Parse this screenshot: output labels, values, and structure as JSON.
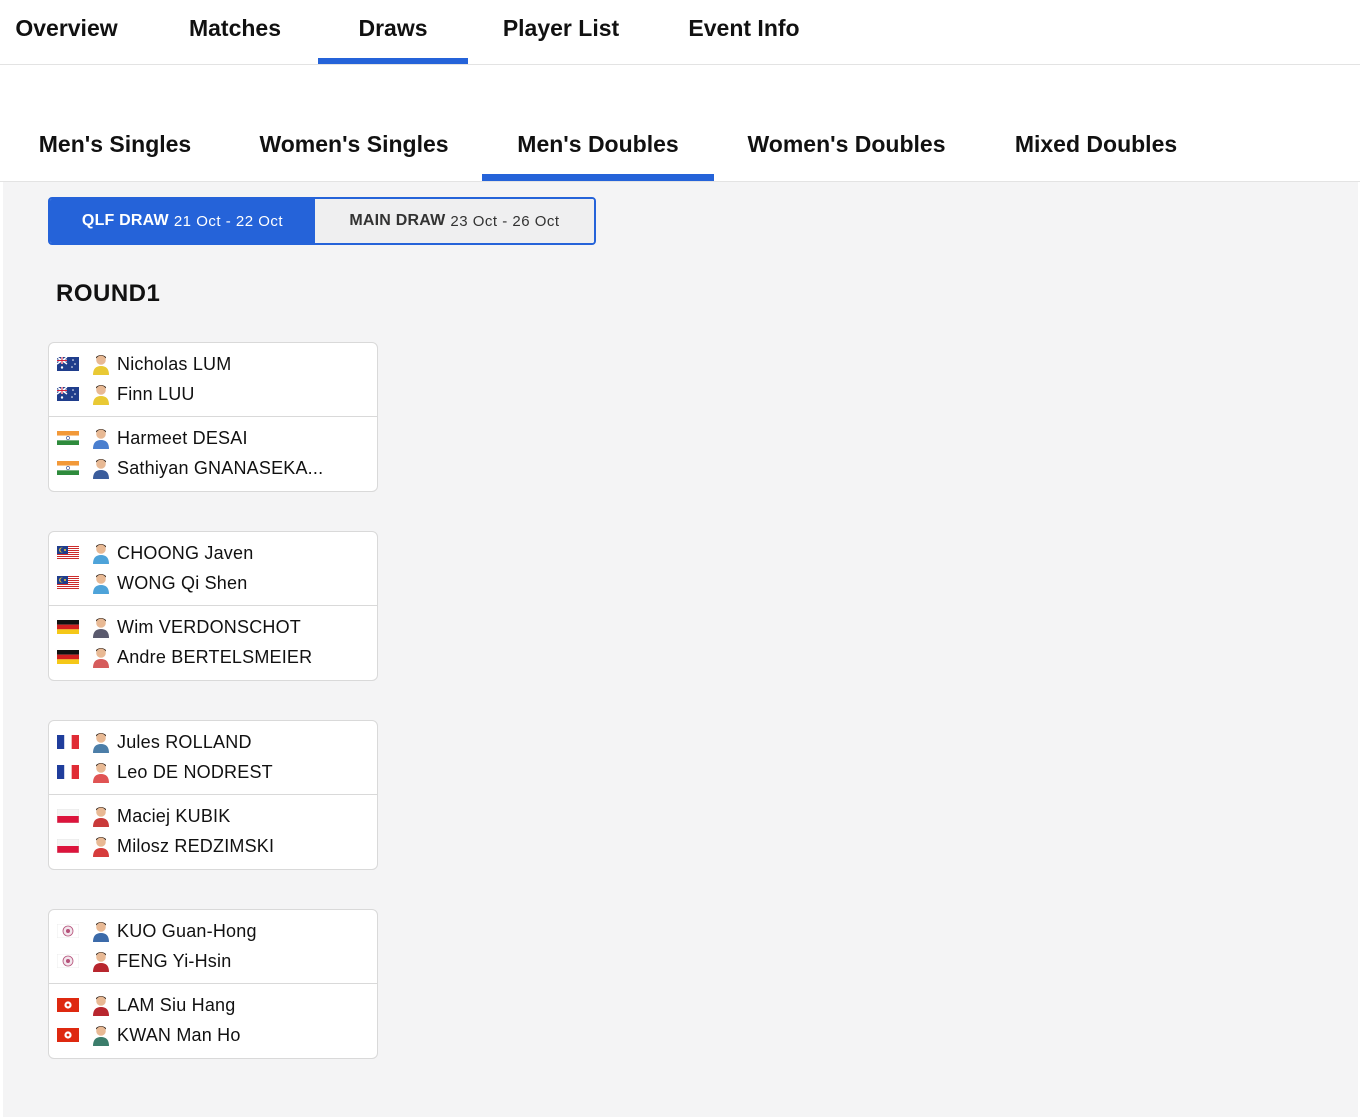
{
  "top_tabs": [
    "Overview",
    "Matches",
    "Draws",
    "Player List",
    "Event Info"
  ],
  "category_tabs": [
    "Men's Singles",
    "Women's Singles",
    "Men's Doubles",
    "Women's Doubles",
    "Mixed Doubles"
  ],
  "draw_toggle": {
    "qlf_label": "QLF DRAW",
    "qlf_dates": "21 Oct - 22 Oct",
    "main_label": "MAIN DRAW",
    "main_dates": "23 Oct - 26 Oct"
  },
  "round_title": "ROUND1",
  "matches": [
    {
      "team1": [
        {
          "name": "Nicholas LUM",
          "flag": "aus-flag-icon"
        },
        {
          "name": "Finn LUU",
          "flag": "aus-flag-icon"
        }
      ],
      "team2": [
        {
          "name": "Harmeet DESAI",
          "flag": "ind-flag-icon"
        },
        {
          "name": "Sathiyan GNANASEKA...",
          "flag": "ind-flag-icon"
        }
      ]
    },
    {
      "team1": [
        {
          "name": "CHOONG Javen",
          "flag": "mas-flag-icon"
        },
        {
          "name": "WONG Qi Shen",
          "flag": "mas-flag-icon"
        }
      ],
      "team2": [
        {
          "name": "Wim VERDONSCHOT",
          "flag": "ger-flag-icon"
        },
        {
          "name": "Andre BERTELSMEIER",
          "flag": "ger-flag-icon"
        }
      ]
    },
    {
      "team1": [
        {
          "name": "Jules ROLLAND",
          "flag": "fra-flag-icon"
        },
        {
          "name": "Leo DE NODREST",
          "flag": "fra-flag-icon"
        }
      ],
      "team2": [
        {
          "name": "Maciej KUBIK",
          "flag": "pol-flag-icon"
        },
        {
          "name": "Milosz REDZIMSKI",
          "flag": "pol-flag-icon"
        }
      ]
    },
    {
      "team1": [
        {
          "name": "KUO Guan-Hong",
          "flag": "tpe-flag-icon"
        },
        {
          "name": "FENG Yi-Hsin",
          "flag": "tpe-flag-icon"
        }
      ],
      "team2": [
        {
          "name": "LAM Siu Hang",
          "flag": "hkg-flag-icon"
        },
        {
          "name": "KWAN Man Ho",
          "flag": "hkg-flag-icon"
        }
      ]
    }
  ],
  "colors": {
    "accent": "#2563d9",
    "content_bg": "#f4f4f5"
  }
}
